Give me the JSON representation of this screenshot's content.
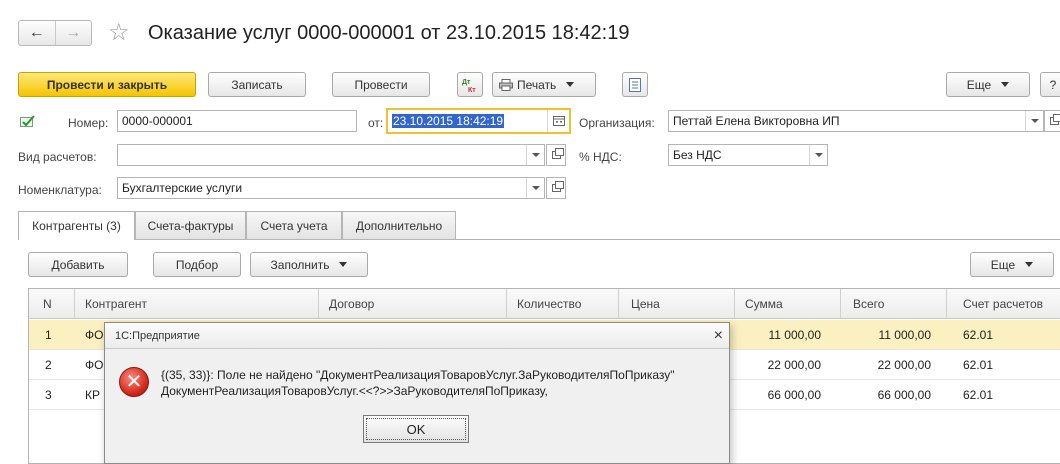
{
  "header": {
    "title": "Оказание услуг 0000-000001 от 23.10.2015 18:42:19",
    "back_arrow": "←",
    "forward_arrow": "→",
    "star": "☆"
  },
  "toolbar": {
    "post_close_label": "Провести и закрыть",
    "save_label": "Записать",
    "post_label": "Провести",
    "dt_kt_label": "Дт Кт",
    "print_label": "Печать",
    "more_label": "Еще",
    "help_label": "?"
  },
  "form": {
    "number_label": "Номер:",
    "number_value": "0000-000001",
    "date_label": "от:",
    "date_value": "23.10.2015 18:42:19",
    "org_label": "Организация:",
    "org_value": "Петтай Елена Викторовна ИП",
    "calc_type_label": "Вид расчетов:",
    "calc_type_value": "",
    "vat_label": "% НДС:",
    "vat_value": "Без НДС",
    "nomenclature_label": "Номенклатура:",
    "nomenclature_value": "Бухгалтерские услуги"
  },
  "tabs": [
    {
      "label": "Контрагенты (3)"
    },
    {
      "label": "Счета-фактуры"
    },
    {
      "label": "Счета учета"
    },
    {
      "label": "Дополнительно"
    }
  ],
  "table_toolbar": {
    "add_label": "Добавить",
    "select_label": "Подбор",
    "fill_label": "Заполнить",
    "more_label": "Еще"
  },
  "table": {
    "columns": [
      "N",
      "Контрагент",
      "Договор",
      "Количество",
      "Цена",
      "Сумма",
      "Всего",
      "Счет расчетов"
    ],
    "rows": [
      {
        "n": "1",
        "contractor": "ФО",
        "sum": "11 000,00",
        "total": "11 000,00",
        "account": "62.01"
      },
      {
        "n": "2",
        "contractor": "ФО",
        "sum": "22 000,00",
        "total": "22 000,00",
        "account": "62.01"
      },
      {
        "n": "3",
        "contractor": "КР",
        "sum": "66 000,00",
        "total": "66 000,00",
        "account": "62.01"
      }
    ]
  },
  "dialog": {
    "title": "1С:Предприятие",
    "close": "×",
    "line1": "{(35, 33)}: Поле не найдено \"ДокументРеализацияТоваровУслуг.ЗаРуководителяПоПриказу\"",
    "line2": "ДокументРеализацияТоваровУслуг.<<?>>ЗаРуководителяПоПриказу,",
    "ok_label": "OK",
    "icon_glyph": "✕"
  }
}
